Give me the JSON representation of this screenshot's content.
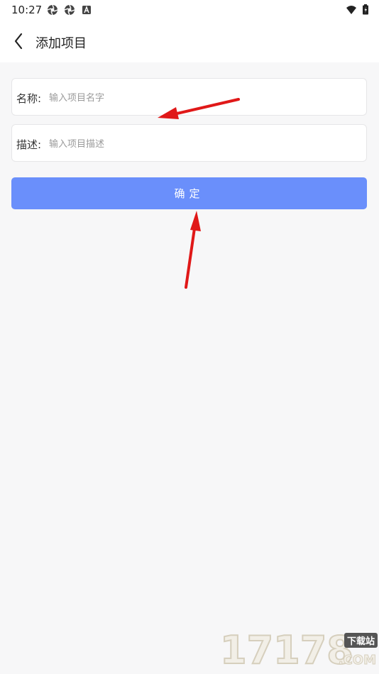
{
  "status_bar": {
    "time": "10:27",
    "left_icons": [
      "aperture-icon",
      "aperture-icon",
      "a-box-icon"
    ],
    "right_icons": [
      "wifi-icon",
      "battery-icon"
    ]
  },
  "header": {
    "back_icon": "chevron-left-icon",
    "title": "添加项目"
  },
  "form": {
    "name_label": "名称:",
    "name_placeholder": "输入项目名字",
    "name_value": "",
    "description_label": "描述:",
    "description_placeholder": "输入项目描述",
    "description_value": ""
  },
  "confirm_button": {
    "label": "确定",
    "color": "#6a8ffb"
  },
  "annotations": {
    "arrow_color": "#e01818"
  },
  "watermark": {
    "digits": "17178",
    "tag": "下载站",
    "domain": ".COM"
  },
  "colors": {
    "background": "#f7f7f8",
    "surface": "#ffffff"
  }
}
